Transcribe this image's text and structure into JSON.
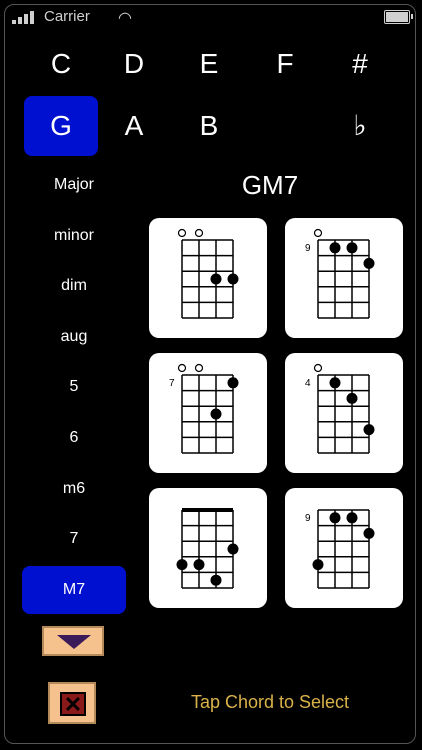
{
  "status": {
    "carrier": "Carrier"
  },
  "notes": [
    "C",
    "D",
    "E",
    "F",
    "#",
    "G",
    "A",
    "B",
    "♭"
  ],
  "selected_note": "G",
  "qualities": [
    "Major",
    "minor",
    "dim",
    "aug",
    "5",
    "6",
    "m6",
    "7",
    "M7"
  ],
  "selected_quality": "M7",
  "chord_name": "GM7",
  "diagrams": [
    {
      "fret_label": "",
      "nut": false,
      "open": [
        0,
        1
      ],
      "dots": [
        [
          2,
          3
        ],
        [
          3,
          3
        ]
      ]
    },
    {
      "fret_label": "9",
      "nut": false,
      "open": [
        0
      ],
      "dots": [
        [
          1,
          1
        ],
        [
          2,
          1
        ],
        [
          3,
          2
        ]
      ]
    },
    {
      "fret_label": "7",
      "nut": false,
      "open": [
        0,
        1
      ],
      "dots": [
        [
          3,
          1
        ],
        [
          2,
          3
        ]
      ]
    },
    {
      "fret_label": "4",
      "nut": false,
      "open": [
        0
      ],
      "dots": [
        [
          1,
          1
        ],
        [
          2,
          2
        ],
        [
          3,
          4
        ]
      ]
    },
    {
      "fret_label": "",
      "nut": true,
      "open": [],
      "dots": [
        [
          3,
          3
        ],
        [
          0,
          4
        ],
        [
          1,
          4
        ],
        [
          2,
          5
        ]
      ]
    },
    {
      "fret_label": "9",
      "nut": false,
      "open": [],
      "dots": [
        [
          1,
          1
        ],
        [
          2,
          1
        ],
        [
          3,
          2
        ],
        [
          0,
          4
        ]
      ]
    }
  ],
  "hint": "Tap Chord to Select",
  "icons": {
    "down": "down-arrow-icon",
    "close": "close-icon"
  }
}
